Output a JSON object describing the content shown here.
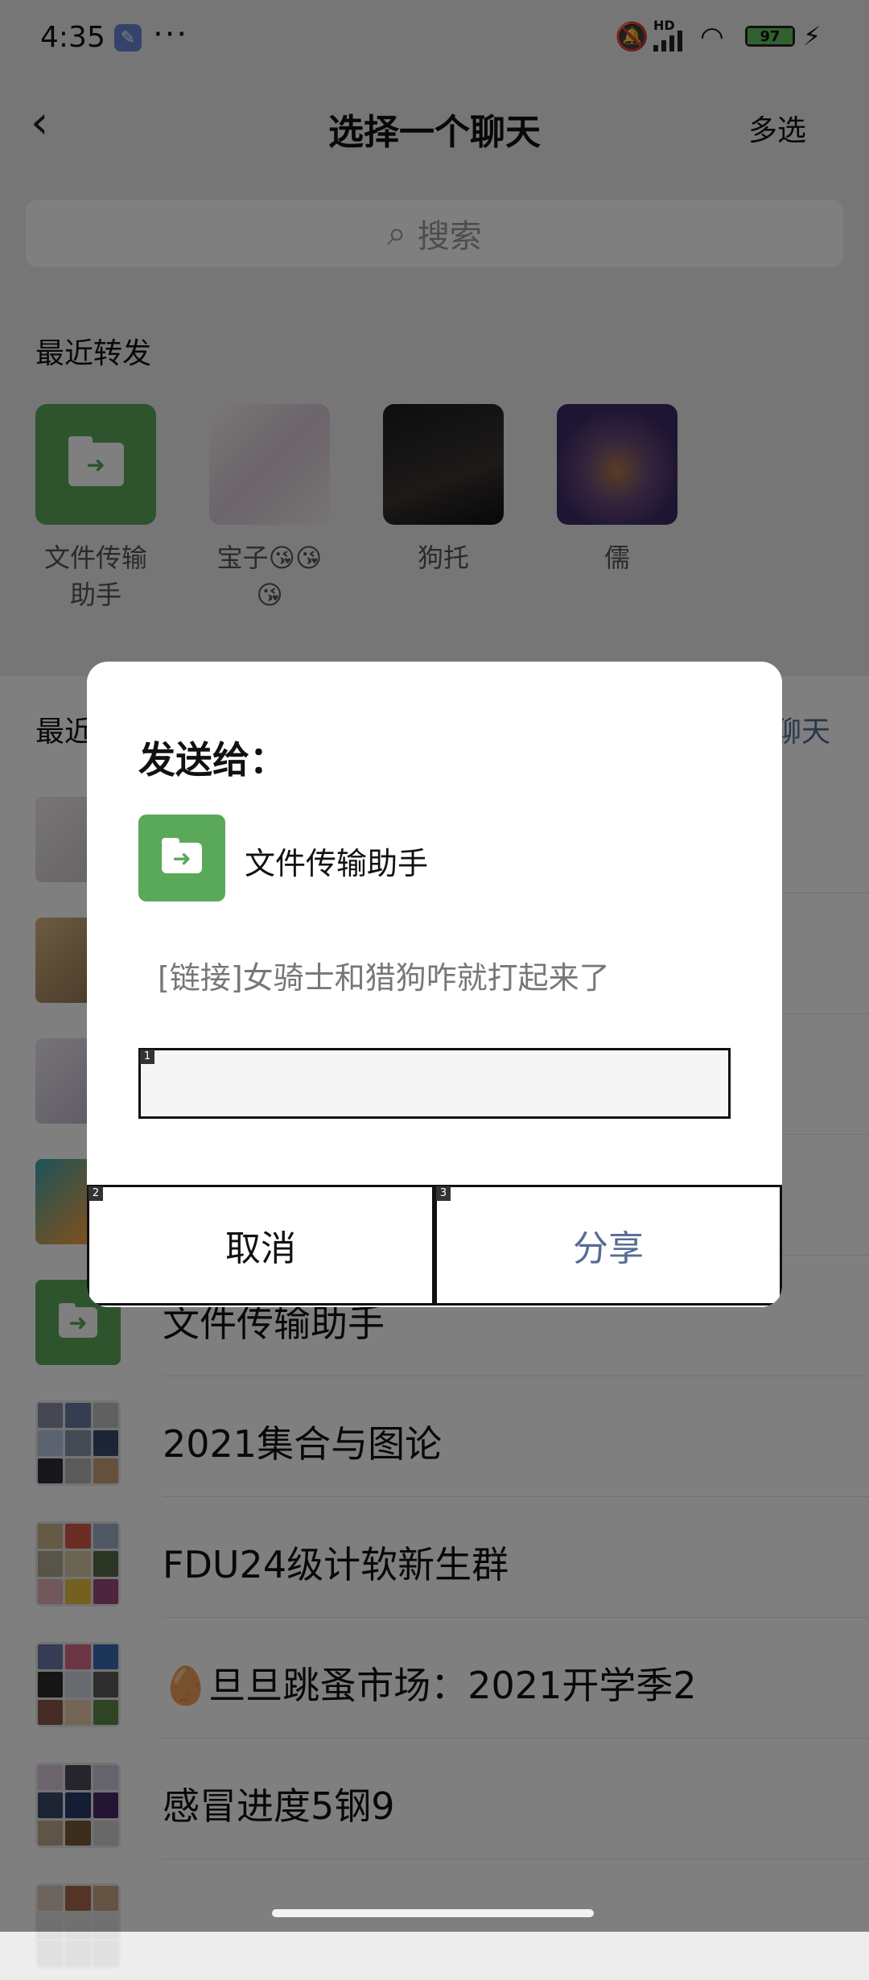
{
  "status_bar": {
    "time": "4:35",
    "more": "···",
    "hd": "HD",
    "battery": "97",
    "icons": [
      "wrench-icon",
      "mute-icon",
      "signal-icon",
      "wifi-icon",
      "battery-icon",
      "charging-icon"
    ]
  },
  "header": {
    "back_icon": "‹",
    "title": "选择一个聊天",
    "multi_select": "多选"
  },
  "search": {
    "icon": "⌕",
    "placeholder": "搜索"
  },
  "recent_forwards": {
    "label": "最近转发",
    "items": [
      {
        "name": "文件传输助手"
      },
      {
        "name": "宝子😘😘😘"
      },
      {
        "name": "狗托"
      },
      {
        "name": "儒"
      }
    ]
  },
  "recent_chats": {
    "label": "最近",
    "create_link": "聊天",
    "rows": [
      {
        "name": "文件传输助手"
      },
      {
        "name": "2021集合与图论"
      },
      {
        "name": "FDU24级计软新生群"
      },
      {
        "name": "🥚旦旦跳蚤市场：2021开学季2"
      },
      {
        "name": "感冒进度5钢9"
      }
    ]
  },
  "dialog": {
    "title": "发送给：",
    "recipient": "文件传输助手",
    "message": "[链接]女骑士和猎狗咋就打起来了",
    "input_value": "",
    "cancel": "取消",
    "share": "分享",
    "tags": [
      "1",
      "2",
      "3"
    ]
  },
  "colors": {
    "file_transfer_green": "#5aa85a",
    "link_blue": "#576b95",
    "battery_green": "#63c25c"
  }
}
